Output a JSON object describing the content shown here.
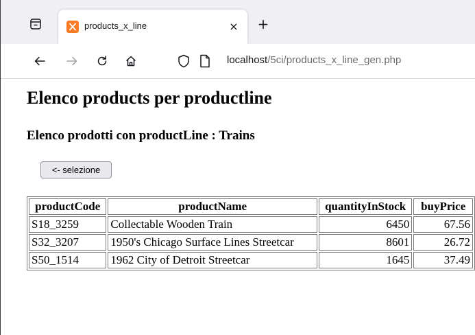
{
  "browser": {
    "tab": {
      "title": "products_x_line",
      "close_symbol": "×"
    },
    "new_tab_symbol": "+",
    "url": {
      "host": "localhost",
      "path": "/5ci/products_x_line_gen.php"
    }
  },
  "page": {
    "title": "Elenco products per productline",
    "subtitle": "Elenco prodotti con productLine : Trains",
    "back_button": "<- selezione"
  },
  "table": {
    "headers": [
      "productCode",
      "productName",
      "quantityInStock",
      "buyPrice"
    ],
    "rows": [
      [
        "S18_3259",
        "Collectable Wooden Train",
        "6450",
        "67.56"
      ],
      [
        "S32_3207",
        "1950's Chicago Surface Lines Streetcar",
        "8601",
        "26.72"
      ],
      [
        "S50_1514",
        "1962 City of Detroit Streetcar",
        "1645",
        "37.49"
      ]
    ]
  },
  "colors": {
    "favicon": "#fb7a24",
    "chrome_bg": "#f0f0f4"
  }
}
